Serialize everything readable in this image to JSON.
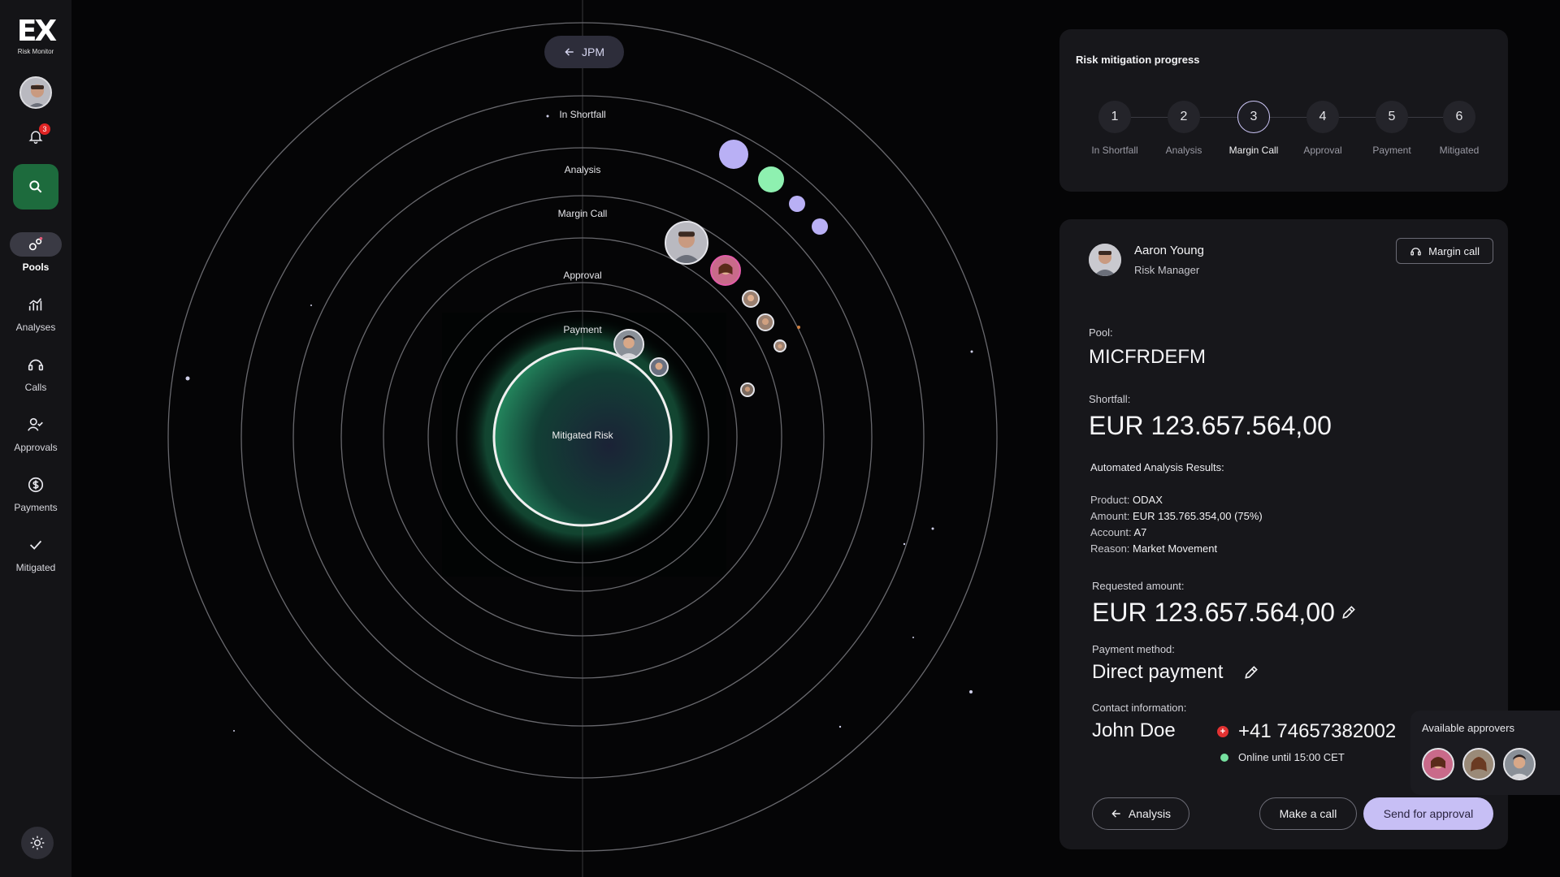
{
  "app": {
    "logo": "EX",
    "name": "Risk Monitor"
  },
  "notifications": {
    "count": "3"
  },
  "nav": [
    {
      "label": "Pools",
      "icon": "pools-icon"
    },
    {
      "label": "Analyses",
      "icon": "analyses-icon"
    },
    {
      "label": "Calls",
      "icon": "calls-icon"
    },
    {
      "label": "Approvals",
      "icon": "approvals-icon"
    },
    {
      "label": "Payments",
      "icon": "payments-icon"
    },
    {
      "label": "Mitigated",
      "icon": "check-icon"
    }
  ],
  "orbit": {
    "back_label": "JPM",
    "rings": [
      "In Shortfall",
      "Analysis",
      "Margin Call",
      "Approval",
      "Payment"
    ],
    "center": "Mitigated Risk"
  },
  "progress": {
    "title": "Risk mitigation progress",
    "current_step": 3,
    "steps": [
      {
        "num": "1",
        "label": "In Shortfall"
      },
      {
        "num": "2",
        "label": "Analysis"
      },
      {
        "num": "3",
        "label": "Margin Call"
      },
      {
        "num": "4",
        "label": "Approval"
      },
      {
        "num": "5",
        "label": "Payment"
      },
      {
        "num": "6",
        "label": "Mitigated"
      }
    ]
  },
  "detail": {
    "user_name": "Aaron Young",
    "user_role": "Risk Manager",
    "action_button": "Margin call",
    "pool_label": "Pool:",
    "pool_value": "MICFRDEFM",
    "shortfall_label": "Shortfall:",
    "shortfall_value": "EUR 123.657.564,00",
    "analysis_title": "Automated Analysis Results:",
    "product_label": "Product:",
    "product_value": "ODAX",
    "amount_label": "Amount:",
    "amount_value": "EUR 135.765.354,00 (75%)",
    "account_label": "Account:",
    "account_value": "A7",
    "reason_label": "Reason:",
    "reason_value": "Market Movement",
    "requested_label": "Requested amount:",
    "requested_value": "EUR 123.657.564,00",
    "payment_label": "Payment method:",
    "payment_value": "Direct payment",
    "contact_label": "Contact information:",
    "contact_name": "John Doe",
    "phone": "+41 74657382002",
    "status": "Online until 15:00 CET",
    "btn_back": "Analysis",
    "btn_call": "Make a call",
    "btn_send": "Send for approval"
  },
  "approvers": {
    "title": "Available approvers"
  },
  "colors": {
    "accent": "#c7bff5",
    "search": "#1d6b3d",
    "online": "#76e0a0",
    "bubble_green": "#8ef0b0",
    "bubble_purple": "#b9b0f5"
  }
}
